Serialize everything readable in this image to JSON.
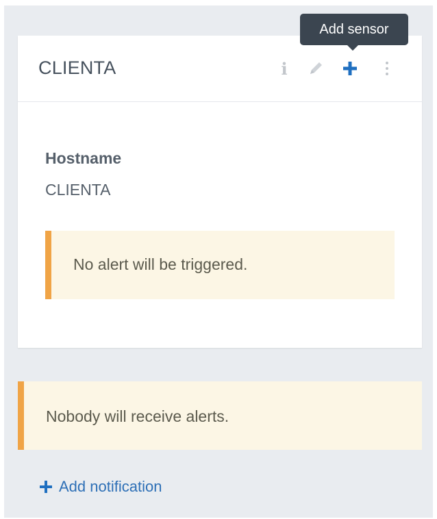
{
  "card": {
    "title": "CLIENTA",
    "actions": {
      "info": {
        "icon": "info-icon"
      },
      "edit": {
        "icon": "pencil-icon"
      },
      "add": {
        "icon": "plus-icon",
        "tooltip": "Add sensor"
      },
      "more": {
        "icon": "more-vertical-icon"
      }
    },
    "field": {
      "label": "Hostname",
      "value": "CLIENTA"
    },
    "alert": {
      "text": "No alert will be triggered."
    }
  },
  "notifications": {
    "alert": {
      "text": "Nobody will receive alerts."
    },
    "add_label": "Add notification"
  },
  "colors": {
    "accent": "#1f6fc0",
    "warning_border": "#f0a446",
    "warning_bg": "#fcf6e5",
    "panel_bg": "#e9ecf0",
    "tooltip_bg": "#3b4550"
  }
}
